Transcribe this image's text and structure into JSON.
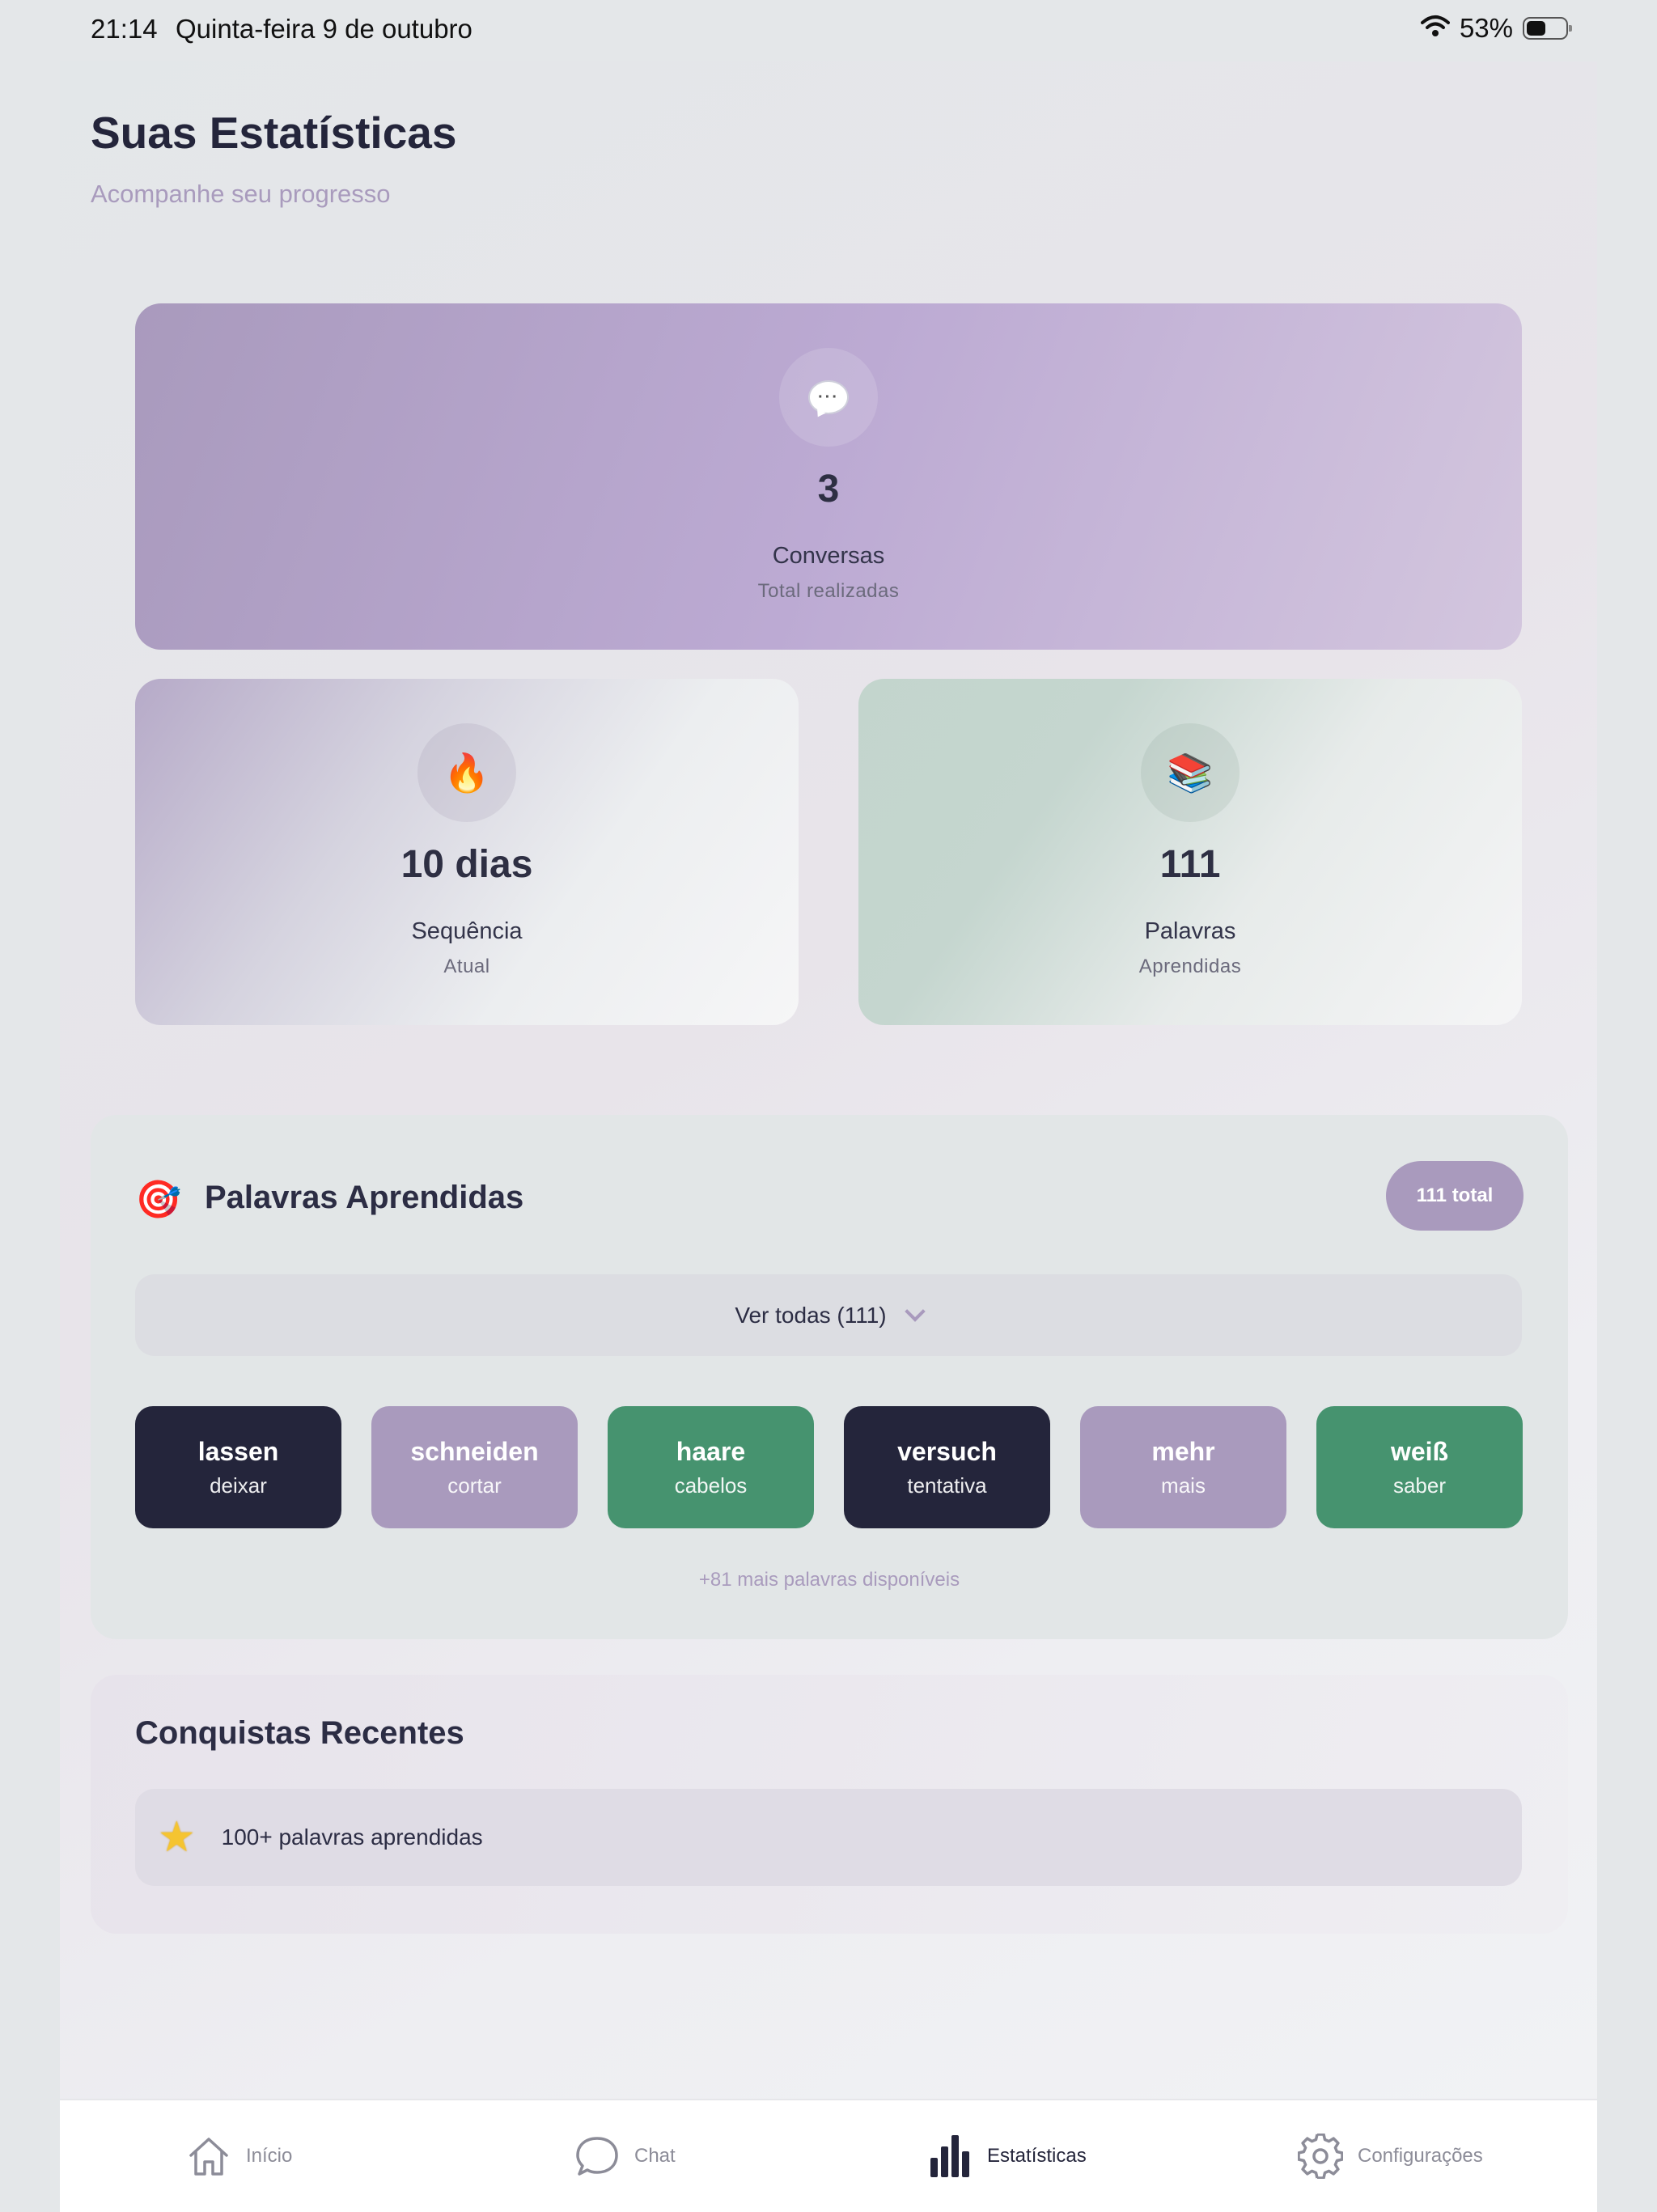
{
  "status_bar": {
    "time": "21:14",
    "date": "Quinta-feira 9 de outubro",
    "battery": "53%",
    "battery_level": 0.53
  },
  "header": {
    "title": "Suas Estatísticas",
    "subtitle": "Acompanhe seu progresso"
  },
  "stats": {
    "conversations": {
      "icon": "speech-bubble-icon",
      "value": "3",
      "label": "Conversas",
      "sub": "Total realizadas"
    },
    "streak": {
      "icon": "fire-icon",
      "value": "10 dias",
      "label": "Sequência",
      "sub": "Atual"
    },
    "words": {
      "icon": "books-icon",
      "value": "111",
      "label": "Palavras",
      "sub": "Aprendidas"
    }
  },
  "learned_words": {
    "icon": "target-icon",
    "title": "Palavras Aprendidas",
    "total_badge": "111 total",
    "toggle_label": "Ver todas (111)",
    "chips": [
      {
        "word": "lassen",
        "translation": "deixar",
        "color": "#24253b"
      },
      {
        "word": "schneiden",
        "translation": "cortar",
        "color": "#a99abd"
      },
      {
        "word": "haare",
        "translation": "cabelos",
        "color": "#46936f"
      },
      {
        "word": "versuch",
        "translation": "tentativa",
        "color": "#24253b"
      },
      {
        "word": "mehr",
        "translation": "mais",
        "color": "#a99abd"
      },
      {
        "word": "weiß",
        "translation": "saber",
        "color": "#46936f"
      }
    ],
    "more_note": "+81 mais palavras disponíveis"
  },
  "achievements": {
    "title": "Conquistas Recentes",
    "items": [
      {
        "icon": "star-icon",
        "text": "100+ palavras aprendidas"
      }
    ]
  },
  "tab_bar": {
    "tabs": [
      {
        "icon": "home-icon",
        "label": "Início",
        "active": false
      },
      {
        "icon": "chat-icon",
        "label": "Chat",
        "active": false
      },
      {
        "icon": "bar-chart-icon",
        "label": "Estatísticas",
        "active": true
      },
      {
        "icon": "gear-icon",
        "label": "Configurações",
        "active": false
      }
    ]
  },
  "colors": {
    "primary_dark": "#24253b",
    "accent_purple": "#a99abd",
    "accent_green": "#46936f"
  }
}
